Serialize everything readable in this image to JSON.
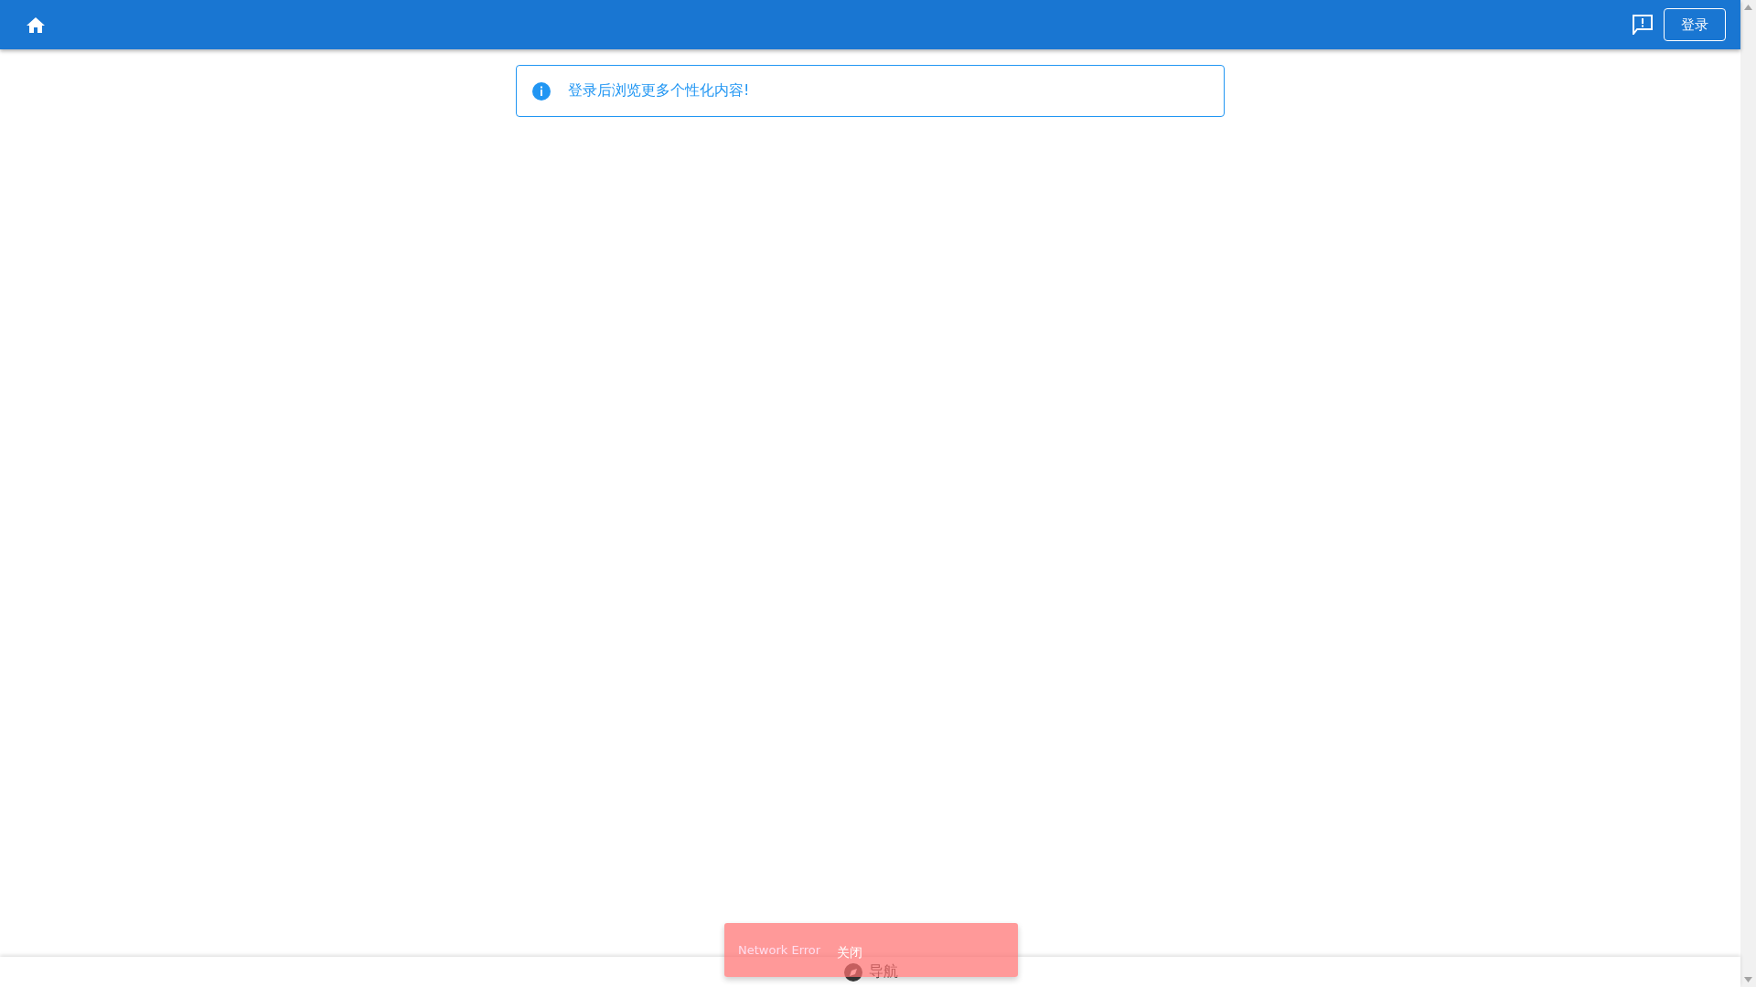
{
  "header": {
    "login_button": "登录"
  },
  "alert": {
    "text": "登录后浏览更多个性化内容!"
  },
  "snackbar": {
    "message": "Network Error",
    "action": "关闭"
  },
  "bottom_nav": {
    "items": [
      {
        "label": "导航",
        "selected": false
      }
    ]
  }
}
